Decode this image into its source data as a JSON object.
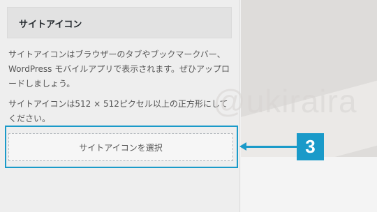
{
  "section": {
    "title": "サイトアイコン"
  },
  "description": {
    "paragraph1": "サイトアイコンはブラウザーのタブやブックマークバー、WordPress モバイルアプリで表示されます。ぜひアップロードしましょう。",
    "paragraph2": "サイトアイコンは512 × 512ピクセル以上の正方形にしてください。"
  },
  "select_button": {
    "label": "サイトアイコンを選択"
  },
  "watermark": {
    "text": "@ukiraira"
  },
  "annotation": {
    "step_number": "3",
    "color": "#1a9ac9"
  },
  "icons": {
    "arrow": "left-arrow-icon"
  }
}
